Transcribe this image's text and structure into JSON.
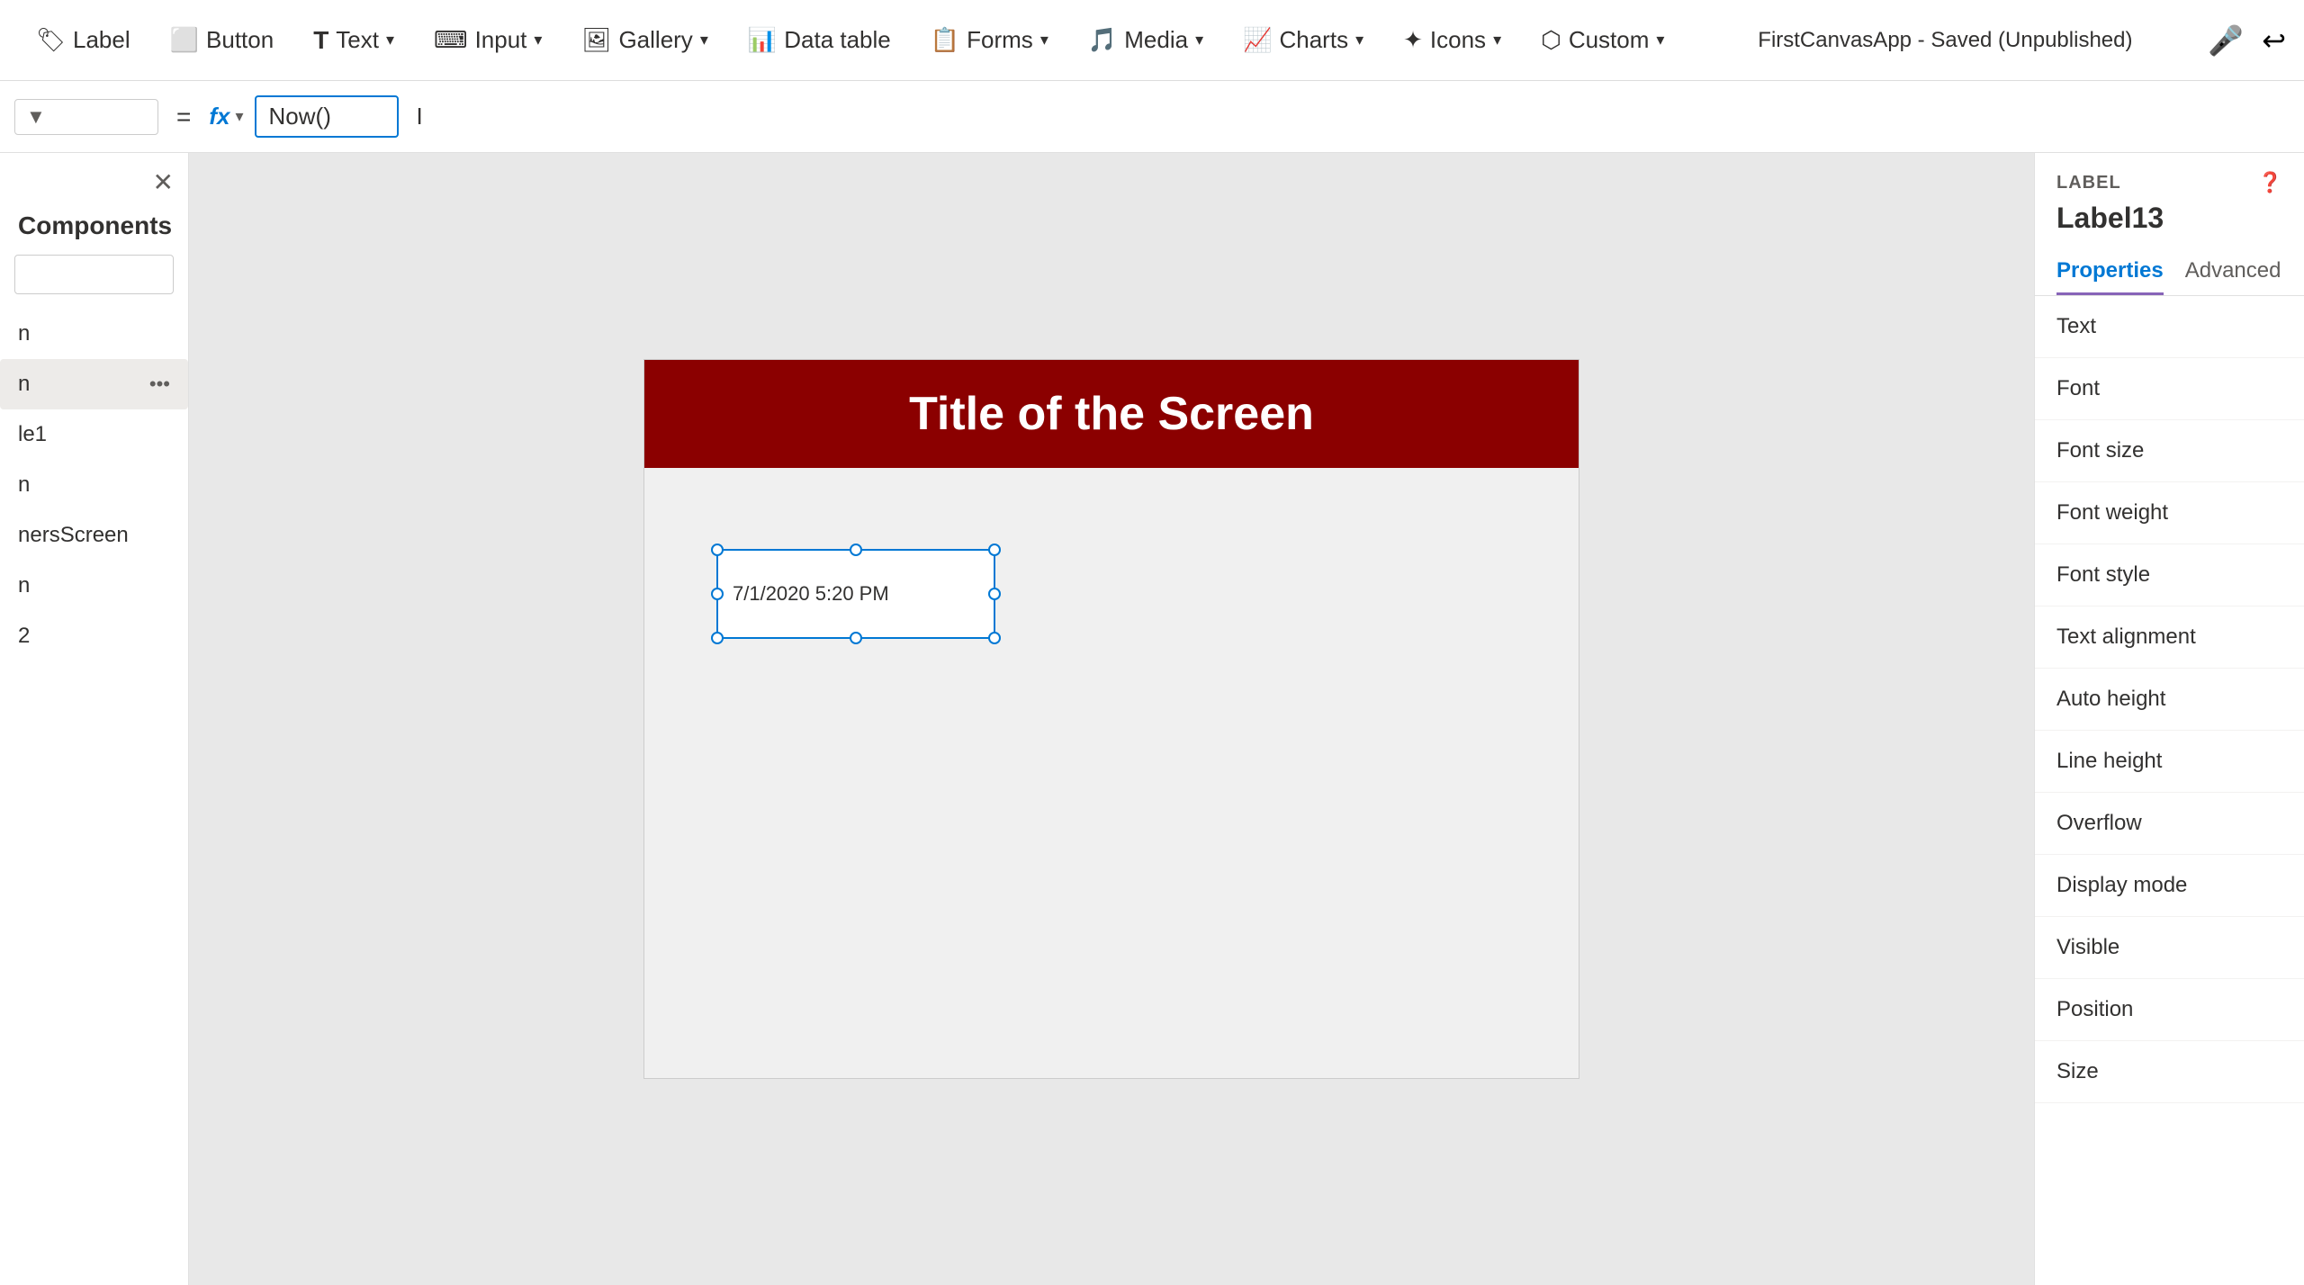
{
  "appTitle": "FirstCanvasApp - Saved (Unpublished)",
  "topNav": {
    "items": [
      {
        "id": "label",
        "icon": "🏷",
        "label": "Label"
      },
      {
        "id": "button",
        "icon": "⬜",
        "label": "Button"
      },
      {
        "id": "text",
        "icon": "T",
        "label": "Text",
        "hasChevron": true
      },
      {
        "id": "input",
        "icon": "⌨",
        "label": "Input",
        "hasChevron": true
      },
      {
        "id": "gallery",
        "icon": "🖼",
        "label": "Gallery",
        "hasChevron": true
      },
      {
        "id": "datatable",
        "icon": "📊",
        "label": "Data table"
      },
      {
        "id": "forms",
        "icon": "📋",
        "label": "Forms",
        "hasChevron": true
      },
      {
        "id": "media",
        "icon": "🎵",
        "label": "Media",
        "hasChevron": true
      },
      {
        "id": "charts",
        "icon": "📈",
        "label": "Charts",
        "hasChevron": true
      },
      {
        "id": "icons",
        "icon": "✦",
        "label": "Icons",
        "hasChevron": true
      },
      {
        "id": "custom",
        "icon": "⬡",
        "label": "Custom",
        "hasChevron": true
      }
    ]
  },
  "formulaBar": {
    "dropdownValue": "",
    "eqSign": "=",
    "fxLabel": "fx",
    "formulaValue": "Now()",
    "cursor": "I"
  },
  "sidebar": {
    "title": "Components",
    "searchPlaceholder": "",
    "items": [
      {
        "id": "item1",
        "label": "n",
        "hasDots": false
      },
      {
        "id": "item2",
        "label": "n",
        "hasDots": true
      },
      {
        "id": "item3",
        "label": "le1",
        "hasDots": false
      },
      {
        "id": "item4",
        "label": "n",
        "hasDots": false
      },
      {
        "id": "item5",
        "label": "nersScreen",
        "hasDots": false
      },
      {
        "id": "item6",
        "label": "n",
        "hasDots": false
      },
      {
        "id": "item7",
        "label": "2",
        "hasDots": false
      }
    ]
  },
  "canvas": {
    "screenTitle": "Title of the Screen",
    "labelValue": "7/1/2020 5:20 PM"
  },
  "rightPanel": {
    "tagLabel": "LABEL",
    "controlName": "Label13",
    "tabs": [
      {
        "id": "properties",
        "label": "Properties",
        "active": true
      },
      {
        "id": "advanced",
        "label": "Advanced",
        "active": false
      }
    ],
    "properties": [
      {
        "id": "text",
        "label": "Text"
      },
      {
        "id": "font",
        "label": "Font"
      },
      {
        "id": "fontsize",
        "label": "Font size"
      },
      {
        "id": "fontweight",
        "label": "Font weight"
      },
      {
        "id": "fontstyle",
        "label": "Font style"
      },
      {
        "id": "textalignment",
        "label": "Text alignment"
      },
      {
        "id": "autoheight",
        "label": "Auto height"
      },
      {
        "id": "lineheight",
        "label": "Line height"
      },
      {
        "id": "overflow",
        "label": "Overflow"
      },
      {
        "id": "displaymode",
        "label": "Display mode"
      },
      {
        "id": "visible",
        "label": "Visible"
      },
      {
        "id": "position",
        "label": "Position"
      },
      {
        "id": "size",
        "label": "Size"
      }
    ]
  }
}
